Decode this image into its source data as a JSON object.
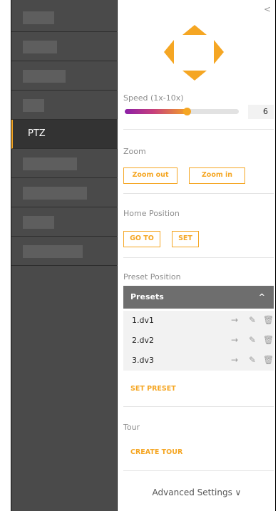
{
  "sidebar": {
    "active_label": "PTZ"
  },
  "panel": {
    "collapse_glyph": "<",
    "speed": {
      "label": "Speed (1x-10x)",
      "value": "6",
      "level": 0.56
    },
    "zoom": {
      "label": "Zoom",
      "zoom_out": "Zoom out",
      "zoom_in": "Zoom in"
    },
    "home": {
      "label": "Home Position",
      "go_to": "GO TO",
      "set": "SET"
    },
    "preset": {
      "label": "Preset Position",
      "header": "Presets",
      "header_chevron": "^",
      "items": [
        {
          "name": "1.dv1"
        },
        {
          "name": "2.dv2"
        },
        {
          "name": "3.dv3"
        }
      ],
      "set_preset": "SET PRESET"
    },
    "tour": {
      "label": "Tour",
      "create": "CREATE TOUR"
    },
    "advanced": "Advanced Settings ∨"
  },
  "icons": {
    "arrow": "→",
    "edit": "✎",
    "delete": "🗑"
  },
  "colors": {
    "accent": "#f5a623",
    "sidebar_bg": "#4a4a4a",
    "sidebar_active_bg": "#333333",
    "presets_header_bg": "#6e6e6e",
    "slider_start": "#8b1fa8"
  }
}
